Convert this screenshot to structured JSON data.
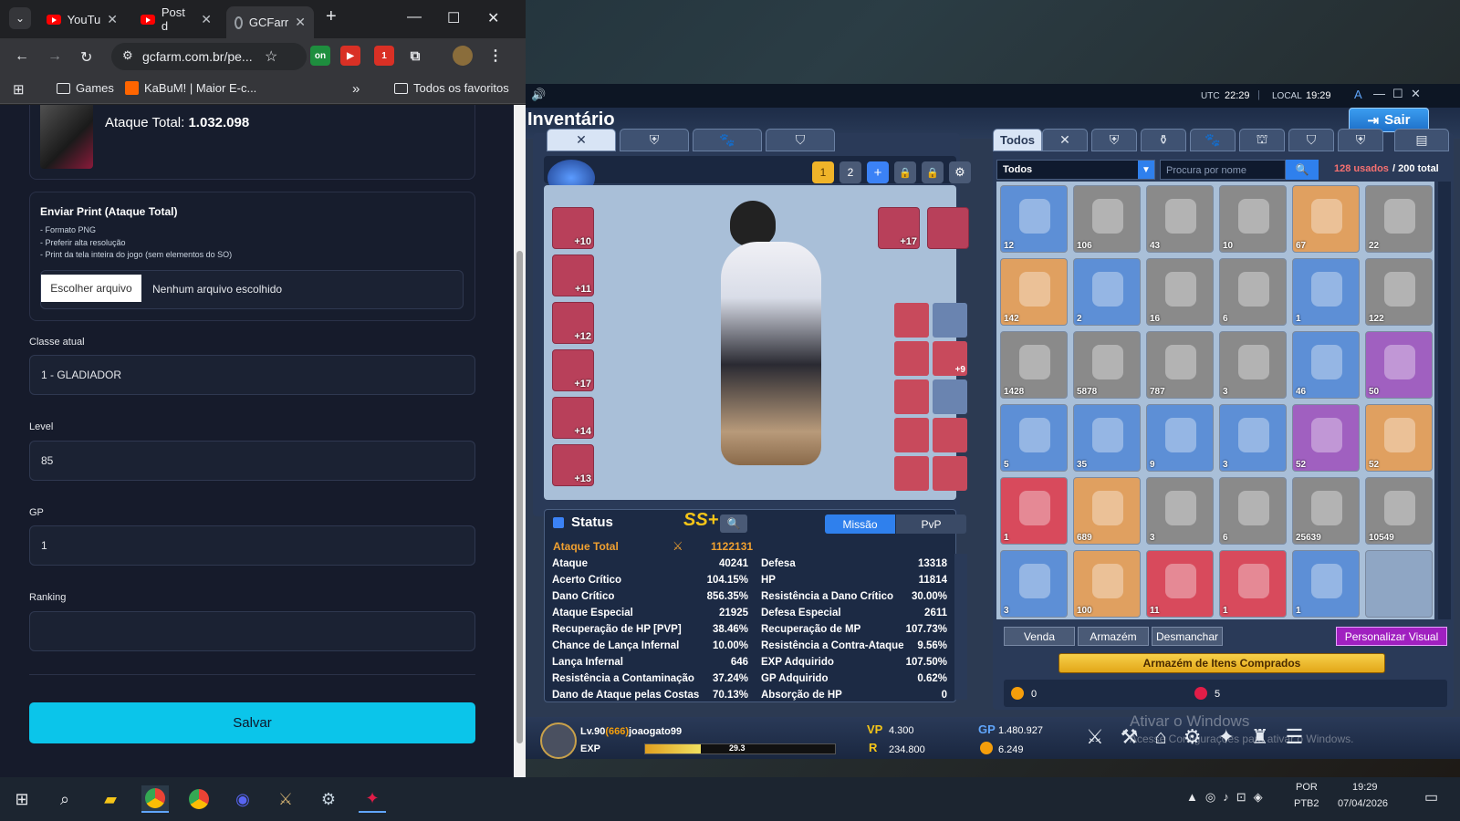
{
  "browser": {
    "tabs": [
      {
        "label": "YouTu"
      },
      {
        "label": "Post d"
      },
      {
        "label": "GCFarr"
      }
    ],
    "url": "gcfarm.com.br/pe...",
    "bookmarks": [
      {
        "label": "Games"
      },
      {
        "label": "KaBuM! | Maior E-c..."
      }
    ],
    "all_bookmarks": "Todos os favoritos",
    "ext_badge_on": "on",
    "ext_badge_count": "1"
  },
  "form": {
    "attack_label": "Ataque Total:",
    "attack_value": "1.032.098",
    "upload_title": "Enviar Print (Ataque Total)",
    "upload_rules": [
      "- Formato PNG",
      "- Preferir alta resolução",
      "- Print da tela inteira do jogo (sem elementos do SO)"
    ],
    "choose_file": "Escolher arquivo",
    "no_file": "Nenhum arquivo escolhido",
    "class_label": "Classe atual",
    "class_value": "1 - GLADIADOR",
    "level_label": "Level",
    "level_value": "85",
    "gp_label": "GP",
    "gp_value": "1",
    "ranking_label": "Ranking",
    "ranking_value": "",
    "save": "Salvar"
  },
  "game": {
    "utc_label": "UTC",
    "utc_time": "22:29",
    "local_label": "LOCAL",
    "local_time": "19:29",
    "title": "Inventário",
    "exit": "Sair",
    "preset_1": "1",
    "preset_2": "2",
    "inv_filter_tab": "Todos",
    "filter_select": "Todos",
    "search_placeholder": "Procura por nome",
    "used": "128 usados",
    "total": "/ 200 total",
    "items": [
      {
        "qty": "12",
        "color": "#5d8fd6"
      },
      {
        "qty": "106",
        "color": "#8a8a8a"
      },
      {
        "qty": "43",
        "color": "#8a8a8a"
      },
      {
        "qty": "10",
        "color": "#8a8a8a"
      },
      {
        "qty": "67",
        "color": "#e0a060"
      },
      {
        "qty": "22",
        "color": "#8a8a8a"
      },
      {
        "qty": "142",
        "color": "#e0a060"
      },
      {
        "qty": "2",
        "color": "#5d8fd6"
      },
      {
        "qty": "16",
        "color": "#8a8a8a"
      },
      {
        "qty": "6",
        "color": "#8a8a8a"
      },
      {
        "qty": "1",
        "color": "#5d8fd6"
      },
      {
        "qty": "122",
        "color": "#8a8a8a"
      },
      {
        "qty": "1428",
        "color": "#8a8a8a"
      },
      {
        "qty": "5878",
        "color": "#8a8a8a"
      },
      {
        "qty": "787",
        "color": "#8a8a8a"
      },
      {
        "qty": "3",
        "color": "#8a8a8a"
      },
      {
        "qty": "46",
        "color": "#5d8fd6"
      },
      {
        "qty": "50",
        "color": "#a060c0"
      },
      {
        "qty": "5",
        "color": "#5d8fd6"
      },
      {
        "qty": "35",
        "color": "#5d8fd6"
      },
      {
        "qty": "9",
        "color": "#5d8fd6"
      },
      {
        "qty": "3",
        "color": "#5d8fd6"
      },
      {
        "qty": "52",
        "color": "#a060c0"
      },
      {
        "qty": "52",
        "color": "#e0a060"
      },
      {
        "qty": "1",
        "color": "#d84a5c"
      },
      {
        "qty": "689",
        "color": "#e0a060"
      },
      {
        "qty": "3",
        "color": "#8a8a8a"
      },
      {
        "qty": "6",
        "color": "#8a8a8a"
      },
      {
        "qty": "25639",
        "color": "#8a8a8a"
      },
      {
        "qty": "10549",
        "color": "#8a8a8a"
      },
      {
        "qty": "3",
        "color": "#5d8fd6"
      },
      {
        "qty": "100",
        "color": "#e0a060"
      },
      {
        "qty": "11",
        "color": "#d84a5c"
      },
      {
        "qty": "1",
        "color": "#d84a5c"
      },
      {
        "qty": "1",
        "color": "#5d8fd6"
      }
    ],
    "equip_left_badges": [
      "+10",
      "+11",
      "+12",
      "+17",
      "+14",
      "+13"
    ],
    "weapon_badge": "+17",
    "acc_badge": "+9",
    "status_title": "Status",
    "grade": "SS+",
    "mode_mission": "Missão",
    "mode_pvp": "PvP",
    "total_attack_label": "Ataque Total",
    "total_attack_value": "1122131",
    "stats_left": [
      {
        "l": "Ataque",
        "v": "40241"
      },
      {
        "l": "Acerto Crítico",
        "v": "104.15%"
      },
      {
        "l": "Dano Crítico",
        "v": "856.35%"
      },
      {
        "l": "Ataque Especial",
        "v": "21925"
      },
      {
        "l": "Recuperação de HP [PVP]",
        "v": "38.46%"
      },
      {
        "l": "Chance de Lança Infernal",
        "v": "10.00%"
      },
      {
        "l": "Lança Infernal",
        "v": "646"
      },
      {
        "l": "Resistência a Contaminação",
        "v": "37.24%"
      },
      {
        "l": "Dano de Ataque pelas Costas",
        "v": "70.13%"
      }
    ],
    "stats_right": [
      {
        "l": "Defesa",
        "v": "13318"
      },
      {
        "l": "HP",
        "v": "11814"
      },
      {
        "l": "Resistência a Dano Crítico",
        "v": "30.00%"
      },
      {
        "l": "Defesa Especial",
        "v": "2611"
      },
      {
        "l": "Recuperação de MP",
        "v": "107.73%"
      },
      {
        "l": "Resistência a Contra-Ataque",
        "v": "9.56%"
      },
      {
        "l": "EXP Adquirido",
        "v": "107.50%"
      },
      {
        "l": "GP Adquirido",
        "v": "0.62%"
      },
      {
        "l": "Absorção de HP",
        "v": "0"
      }
    ],
    "btn_sell": "Venda",
    "btn_store": "Armazém",
    "btn_dismantle": "Desmanchar",
    "btn_custom": "Personalizar Visual",
    "purchased_storage": "Armazém de Itens Comprados",
    "coin1": "0",
    "coin2": "5",
    "player_level": "Lv.90",
    "player_prefix": "(666)",
    "player_name": "joaogato99",
    "exp_label": "EXP",
    "exp_value": "29.3",
    "exp_fraction": 0.293,
    "vp_label": "VP",
    "vp_value": "4.300",
    "gp_label": "GP",
    "gp_value": "1.480.927",
    "r_value": "234.800",
    "coin_value": "6.249",
    "watermark_1": "Ativar o Windows",
    "watermark_2": "Acesse Configurações para ativar o Windows."
  },
  "taskbar": {
    "lang_1": "POR",
    "lang_2": "PTB2",
    "time": "19:29",
    "date": "07/04/2026"
  }
}
